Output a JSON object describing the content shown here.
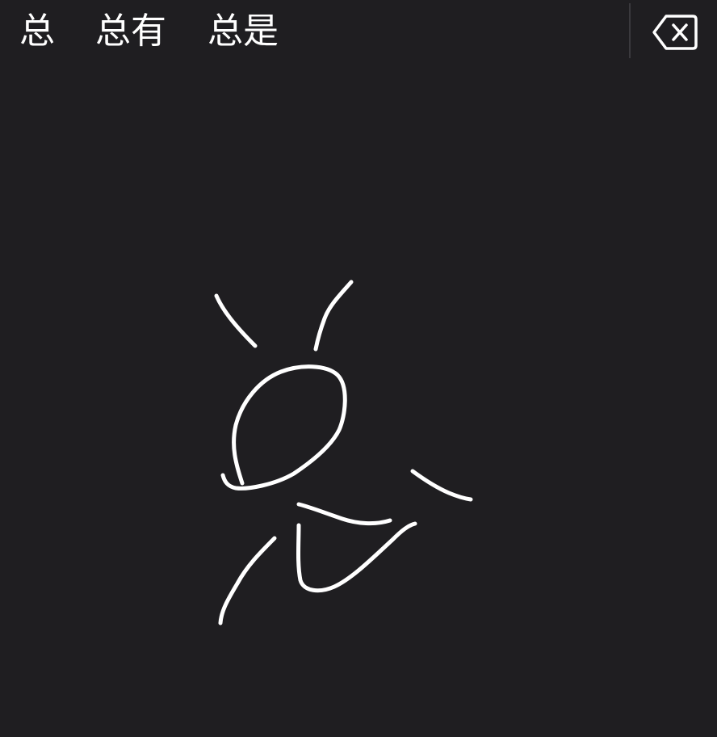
{
  "candidates": [
    {
      "label": "总"
    },
    {
      "label": "总有"
    },
    {
      "label": "总是"
    }
  ],
  "delete_key": {
    "icon": "backspace-icon"
  },
  "handwriting_canvas": {
    "stroke_color": "#ffffff",
    "background_color": "#1f1e21",
    "stroke_count": 8
  }
}
